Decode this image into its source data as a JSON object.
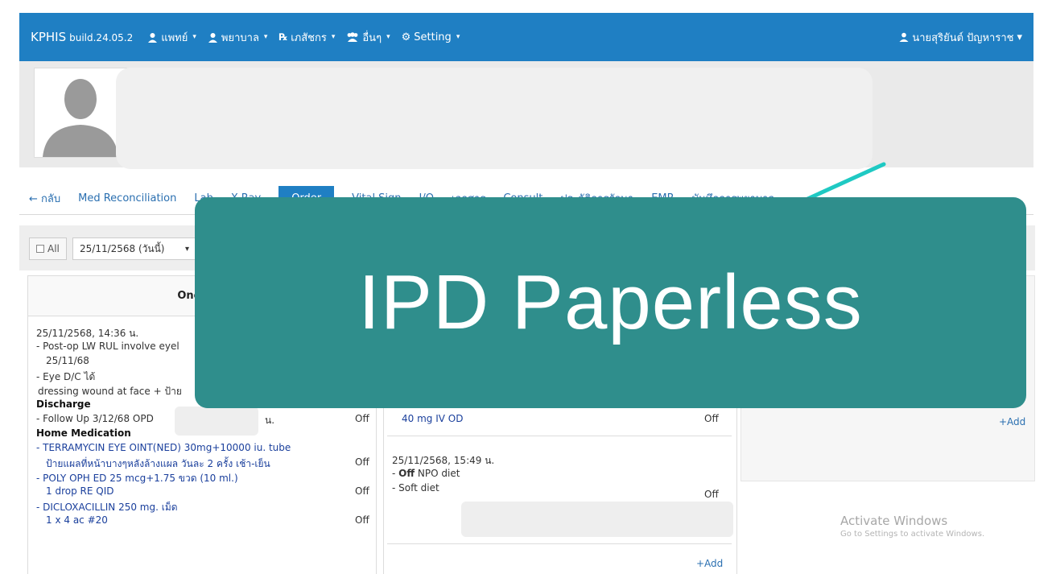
{
  "navbar": {
    "brand": "KPHIS",
    "build": "build.24.05.2",
    "menu": [
      {
        "label": "แพทย์"
      },
      {
        "label": "พยาบาล"
      },
      {
        "label": "เภสัชกร"
      },
      {
        "label": "อื่นๆ"
      },
      {
        "label": "Setting"
      }
    ],
    "user": "นายสุริยันต์ ปัญหาราช"
  },
  "tabs": [
    "← กลับ",
    "Med Reconciliation",
    "Lab",
    "X-Ray",
    "Order",
    "Vital Sign",
    "I/O",
    "เอกสาร",
    "Consult",
    "ประวัติการรักษา",
    "EMR",
    "บันทึกการพยาบาล"
  ],
  "filter": {
    "all_label": "All",
    "date": "25/11/2568 (วันนี้)"
  },
  "one_day": {
    "header": "One Day",
    "entries": [
      "25/11/2568, 14:36 น.",
      "- Post-op LW RUL involve eyel",
      "25/11/68",
      "- Eye D/C ได้",
      "dressing wound at face + ป้าย",
      "Discharge",
      "- Follow Up 3/12/68 OPD",
      "น.",
      "Home Medication",
      "- TERRAMYCIN EYE OINT(NED) 30mg+10000 iu. tube",
      "ป้ายแผลที่หน้าบางๆหลังล้างแผล วันละ 2 ครั้ง เช้า-เย็น",
      "- POLY OPH ED 25 mcg+1.75 ขวด (10 ml.)",
      "1 drop RE QID",
      "- DICLOXACILLIN 250 mg. เม็ด",
      "1 x 4 ac #20"
    ],
    "off_label": "Off"
  },
  "continuous": {
    "entries": [
      "40 mg IV OD",
      "25/11/2568, 15:49 น.",
      "Off",
      "NPO diet",
      "- Soft diet"
    ],
    "off_label": "Off",
    "add_label": "+Add"
  },
  "right_panel": {
    "add_label": "+Add"
  },
  "watermark": {
    "line1": "Activate Windows",
    "line2": "Go to Settings to activate Windows."
  },
  "banner": {
    "title": "IPD Paperless"
  },
  "colors": {
    "navbar": "#1f7fc3",
    "banner": "#2f8e8c",
    "accent_line": "#1fc9c3"
  }
}
